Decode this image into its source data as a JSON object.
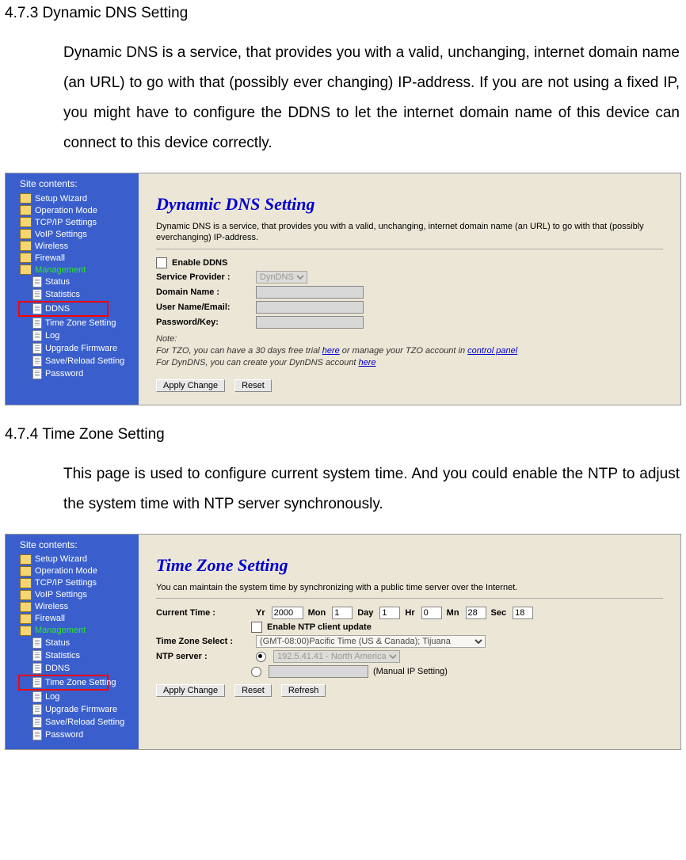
{
  "section1": {
    "number_title": "4.7.3 Dynamic DNS Setting",
    "body": "Dynamic DNS is a service, that provides you with a valid, unchanging, internet domain name (an URL) to go with that (possibly ever changing) IP-address. If you are not using a fixed IP, you might have to configure the DDNS to let the internet domain name of this device can connect to this device correctly."
  },
  "section2": {
    "number_title": "4.7.4 Time Zone Setting",
    "body": "This page is used to configure current system time. And you could enable the NTP to adjust the system time with NTP server synchronously."
  },
  "nav": {
    "title": "Site contents:",
    "items": [
      "Setup Wizard",
      "Operation Mode",
      "TCP/IP Settings",
      "VoIP Settings",
      "Wireless",
      "Firewall"
    ],
    "mgmt": "Management",
    "subs": [
      "Status",
      "Statistics",
      "DDNS",
      "Time Zone Setting",
      "Log",
      "Upgrade Firmware",
      "Save/Reload Setting",
      "Password"
    ]
  },
  "ddns": {
    "title": "Dynamic DNS  Setting",
    "desc": "Dynamic DNS is a service, that provides you with a valid, unchanging, internet domain name (an URL) to go with that (possibly everchanging) IP-address.",
    "enable": "Enable DDNS",
    "provider_label": "Service Provider :",
    "provider_value": "DynDNS",
    "domain_label": "Domain Name :",
    "user_label": "User Name/Email:",
    "pass_label": "Password/Key:",
    "note_title": "Note:",
    "note_line1a": "For TZO, you can have a 30 days free trial ",
    "note_link1": "here",
    "note_line1b": " or manage your TZO account in ",
    "note_link2": "control panel",
    "note_line2a": "For DynDNS, you can create your DynDNS account ",
    "note_link3": "here",
    "btn_apply": "Apply Change",
    "btn_reset": "Reset"
  },
  "tz": {
    "title": "Time Zone Setting",
    "desc": "You can maintain the system time by synchronizing with a public time server over the Internet.",
    "current_label": "Current Time :",
    "yr_label": "Yr",
    "yr_val": "2000",
    "mon_label": "Mon",
    "mon_val": "1",
    "day_label": "Day",
    "day_val": "1",
    "hr_label": "Hr",
    "hr_val": "0",
    "mn_label": "Mn",
    "mn_val": "28",
    "sec_label": "Sec",
    "sec_val": "18",
    "enable_ntp": "Enable NTP client update",
    "tz_label": "Time Zone Select :",
    "tz_value": "(GMT-08:00)Pacific Time (US & Canada); Tijuana",
    "ntp_label": "NTP server :",
    "ntp_value": "192.5.41.41 - North America",
    "manual_label": "(Manual IP Setting)",
    "btn_apply": "Apply Change",
    "btn_reset": "Reset",
    "btn_refresh": "Refresh"
  }
}
